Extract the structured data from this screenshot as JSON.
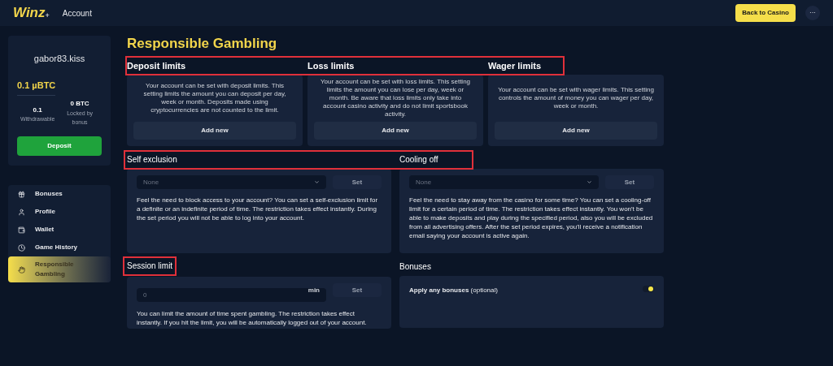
{
  "header": {
    "logo": "Winz",
    "logo_mark": "+",
    "section": "Account",
    "back_button": "Back to Casino",
    "more": "···"
  },
  "account": {
    "username": "gabor83.kiss",
    "balance": "0.1 µBTC",
    "withdrawable_value": "0.1",
    "withdrawable_label": "Withdrawable",
    "locked_value": "0 BTC",
    "locked_label": "Locked by bonus",
    "deposit_button": "Deposit"
  },
  "sidebar": {
    "items": [
      {
        "label": "Bonuses",
        "selected": false
      },
      {
        "label": "Profile",
        "selected": false
      },
      {
        "label": "Wallet",
        "selected": false
      },
      {
        "label": "Game History",
        "selected": false
      },
      {
        "label": "Responsible Gambling",
        "selected": true
      }
    ]
  },
  "page_title": "Responsible Gambling",
  "limits": [
    {
      "title": "Deposit limits",
      "description": "Your account can be set with deposit limits. This setting limits the amount you can deposit per day, week or month. Deposits made using cryptocurrencies are not counted to the limit.",
      "button": "Add new"
    },
    {
      "title": "Loss limits",
      "description": "Your account can be set with loss limits. This setting limits the amount you can lose per day, week or month. Be aware that loss limits only take into account casino activity and do not limit sportsbook activity.",
      "button": "Add new"
    },
    {
      "title": "Wager limits",
      "description": "Your account can be set with wager limits. This setting controls the amount of money you can wager per day, week or month.",
      "button": "Add new"
    }
  ],
  "exclusions": [
    {
      "title": "Self exclusion",
      "select": "None",
      "button": "Set",
      "description": "Feel the need to block access to your account? You can set a self-exclusion limit for a definite or an indefinite period of time. The restriction takes effect instantly. During the set period you will not be able to log into your account."
    },
    {
      "title": "Cooling off",
      "select": "None",
      "button": "Set",
      "description": "Feel the need to stay away from the casino for some time? You can set a cooling-off limit for a certain period of time. The restriction takes effect instantly. You won't be able to make deposits and play during the specified period, also you will be excluded from all advertising offers. After the set period expires, you'll receive a notification email saying your account is active again."
    }
  ],
  "session": {
    "title": "Session limit",
    "placeholder": "0",
    "unit": "min",
    "button": "Set",
    "description": "You can limit the amount of time spent gambling. The restriction takes effect instantly. If you hit the limit, you will be automatically logged out of your account."
  },
  "bonuses": {
    "title": "Bonuses",
    "label": "**Apply any bonuses** (optional)",
    "on": true
  }
}
